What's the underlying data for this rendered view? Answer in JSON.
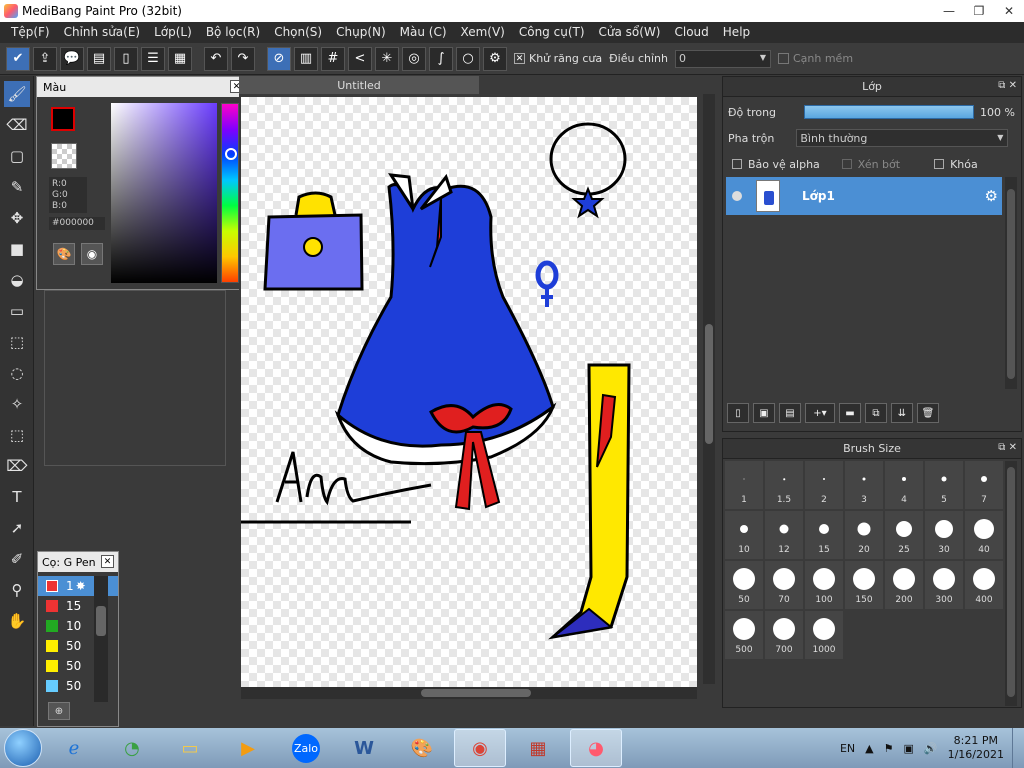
{
  "window": {
    "title": "MediBang Paint Pro (32bit)"
  },
  "menu": [
    "Tệp(F)",
    "Chỉnh sửa(E)",
    "Lớp(L)",
    "Bộ lọc(R)",
    "Chọn(S)",
    "Chụp(N)",
    "Màu (C)",
    "Xem(V)",
    "Công cụ(T)",
    "Cửa sổ(W)",
    "Cloud",
    "Help"
  ],
  "toolbar": {
    "antialias_label": "Khử răng cưa",
    "antialias_checked": "✕",
    "adjust_label": "Điều chỉnh",
    "adjust_value": "0",
    "soft_edge_label": "Cạnh mềm"
  },
  "color_panel": {
    "title": "Màu",
    "r": "R:0",
    "g": "G:0",
    "b": "B:0",
    "hex": "#000000"
  },
  "canvas": {
    "tab": "Untitled"
  },
  "brush_panel": {
    "title": "Cọ: G Pen",
    "items": [
      {
        "size": "1",
        "color": "#ee3333"
      },
      {
        "size": "15",
        "color": "#ee3333"
      },
      {
        "size": "10",
        "color": "#22aa22"
      },
      {
        "size": "50",
        "color": "#ffee00"
      },
      {
        "size": "50",
        "color": "#ffee00"
      },
      {
        "size": "50",
        "color": "#66ccff"
      }
    ]
  },
  "layer_panel": {
    "title": "Lớp",
    "opacity_label": "Độ trong",
    "opacity_value": "100 %",
    "blend_label": "Pha trộn",
    "blend_value": "Bình thường",
    "protect_alpha": "Bảo vệ alpha",
    "clip": "Xén bớt",
    "lock": "Khóa",
    "layer_name": "Lớp1"
  },
  "size_panel": {
    "title": "Brush Size",
    "sizes": [
      "1",
      "1.5",
      "2",
      "3",
      "4",
      "5",
      "7",
      "10",
      "12",
      "15",
      "20",
      "25",
      "30",
      "40",
      "50",
      "70",
      "100",
      "150",
      "200",
      "300",
      "400",
      "500",
      "700",
      "1000"
    ]
  },
  "taskbar": {
    "lang": "EN",
    "time": "8:21 PM",
    "date": "1/16/2021",
    "zalo": "Zalo"
  }
}
